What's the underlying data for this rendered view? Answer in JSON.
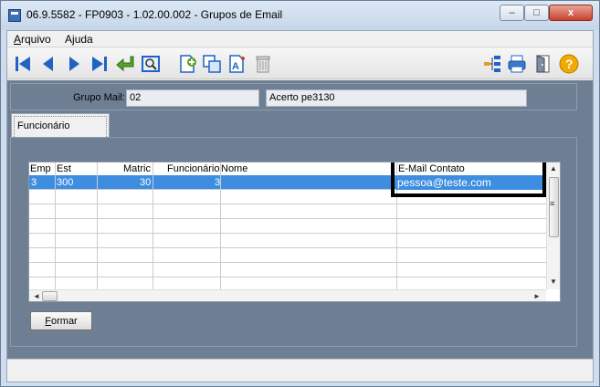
{
  "window": {
    "title": "06.9.5582 - FP0903 - 1.02.00.002 - Grupos de Email",
    "controls": {
      "minimize": "–",
      "maximize": "□",
      "close": "x"
    }
  },
  "menu": {
    "items": [
      {
        "label": "Arquivo",
        "accel": "A",
        "rest": "rquivo"
      },
      {
        "label": "Ajuda",
        "accel": "A",
        "rest_pre": "A",
        "accel2": "j",
        "rest": "uda"
      }
    ]
  },
  "toolbar": {
    "icons": [
      "first-record-icon",
      "previous-record-icon",
      "next-record-icon",
      "last-record-icon",
      "enter-icon",
      "preview-icon",
      "new-document-icon",
      "copy-icon",
      "text-edit-icon",
      "trash-icon",
      "tree-icon",
      "print-icon",
      "exit-door-icon",
      "help-icon"
    ],
    "help_glyph": "?",
    "text_glyph": "A"
  },
  "header": {
    "grupo_label": "Grupo Mail:",
    "grupo_code": "02",
    "grupo_desc": "Acerto pe3130"
  },
  "tabs": [
    {
      "label": "Funcionário"
    }
  ],
  "grid": {
    "columns": [
      "Emp",
      "Est",
      "Matric",
      "Funcionário",
      "Nome",
      "E-Mail Contato"
    ],
    "rows": [
      {
        "emp": "3",
        "est": "300",
        "matric": "30",
        "funcionario": "3",
        "nome": "",
        "email": "pessoa@teste.com"
      }
    ],
    "scroll_up": "▲",
    "scroll_down": "▼",
    "scroll_left": "◄",
    "scroll_right": "►",
    "grip": "≡"
  },
  "buttons": {
    "formar": {
      "accel": "F",
      "rest": "ormar"
    }
  },
  "colors": {
    "panel_bg": "#6e7f93",
    "selection": "#3d8ee0",
    "toolbar_blue": "#1f63c4"
  }
}
